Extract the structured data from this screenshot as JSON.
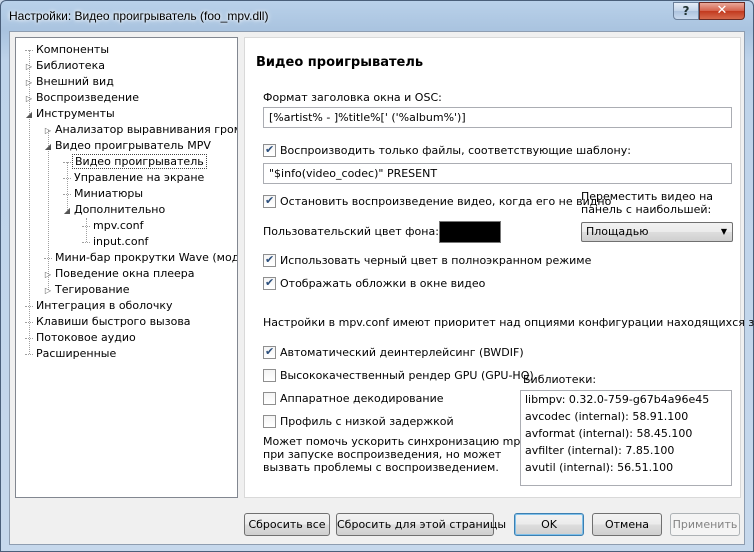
{
  "window": {
    "title": "Настройки: Видео проигрыватель (foo_mpv.dll)",
    "help_label": "?",
    "close_label": "✕"
  },
  "tree": {
    "items": [
      {
        "label": "Компоненты",
        "expander": ""
      },
      {
        "label": "Библиотека",
        "expander": "▷"
      },
      {
        "label": "Внешний вид",
        "expander": "▷"
      },
      {
        "label": "Воспроизведение",
        "expander": "▷"
      },
      {
        "label": "Инструменты",
        "expander": "◢"
      },
      {
        "label": "Анализатор выравнивания громкости",
        "expander": "▷"
      },
      {
        "label": "Видео проигрыватель MPV",
        "expander": "◢"
      },
      {
        "label": "Видео проигрыватель",
        "expander": ""
      },
      {
        "label": "Управление на экране",
        "expander": ""
      },
      {
        "label": "Миниатюры",
        "expander": ""
      },
      {
        "label": "Дополнительно",
        "expander": "◢"
      },
      {
        "label": "mpv.conf",
        "expander": ""
      },
      {
        "label": "input.conf",
        "expander": ""
      },
      {
        "label": "Мини-бар прокрутки Wave (мод)",
        "expander": ""
      },
      {
        "label": "Поведение окна плеера",
        "expander": "▷"
      },
      {
        "label": "Тегирование",
        "expander": "▷"
      },
      {
        "label": "Интеграция в оболочку",
        "expander": ""
      },
      {
        "label": "Клавиши быстрого вызова",
        "expander": ""
      },
      {
        "label": "Потоковое аудио",
        "expander": ""
      },
      {
        "label": "Расширенные",
        "expander": ""
      }
    ],
    "selected_index": 7
  },
  "panel": {
    "heading": "Видео проигрыватель",
    "title_format_label": "Формат заголовка окна и OSC:",
    "title_format_value": "[%artist% - ]%title%[' ('%album%')]",
    "only_files_label": "Воспроизводить только файлы, соответствующие шаблону:",
    "only_files_checked": true,
    "pattern_value": "\"$info(video_codec)\" PRESENT",
    "stop_when_hidden_label": "Остановить воспроизведение видео, когда его не видно",
    "stop_when_hidden_checked": true,
    "move_video_label_1": "Переместить видео на",
    "move_video_label_2": "панель с наибольшей:",
    "move_video_value": "Площадью",
    "bg_color_label": "Пользовательский цвет фона:",
    "bg_color": "#000000",
    "black_fullscreen_label": "Использовать черный цвет в полноэкранном режиме",
    "black_fullscreen_checked": true,
    "show_covers_label": "Отображать обложки в окне видео",
    "show_covers_checked": true,
    "priority_note": "Настройки в mpv.conf имеют приоритет над опциями конфигурации находящихся здесь.",
    "deinterlace_label": "Автоматический деинтерлейсинг (BWDIF)",
    "deinterlace_checked": true,
    "gpu_hq_label": "Высококачественный рендер GPU (GPU-HQ)",
    "gpu_hq_checked": false,
    "hwdec_label": "Аппаратное декодирование",
    "hwdec_checked": false,
    "low_latency_label": "Профиль с низкой задержкой",
    "low_latency_checked": false,
    "low_latency_note_1": "Может помочь ускорить синхронизацию mpv",
    "low_latency_note_2": "при запуске воспроизведения, но может",
    "low_latency_note_3": "вызвать проблемы с воспроизведением.",
    "libraries_label": "Библиотеки:",
    "libraries": [
      "libmpv: 0.32.0-759-g67b4a96e45",
      "avcodec (internal): 58.91.100",
      "avformat (internal): 58.45.100",
      "avfilter (internal): 7.85.100",
      "avutil (internal): 56.51.100"
    ]
  },
  "buttons": {
    "reset_all": "Сбросить все",
    "reset_page": "Сбросить для этой страницы",
    "ok": "OK",
    "cancel": "Отмена",
    "apply": "Применить"
  }
}
